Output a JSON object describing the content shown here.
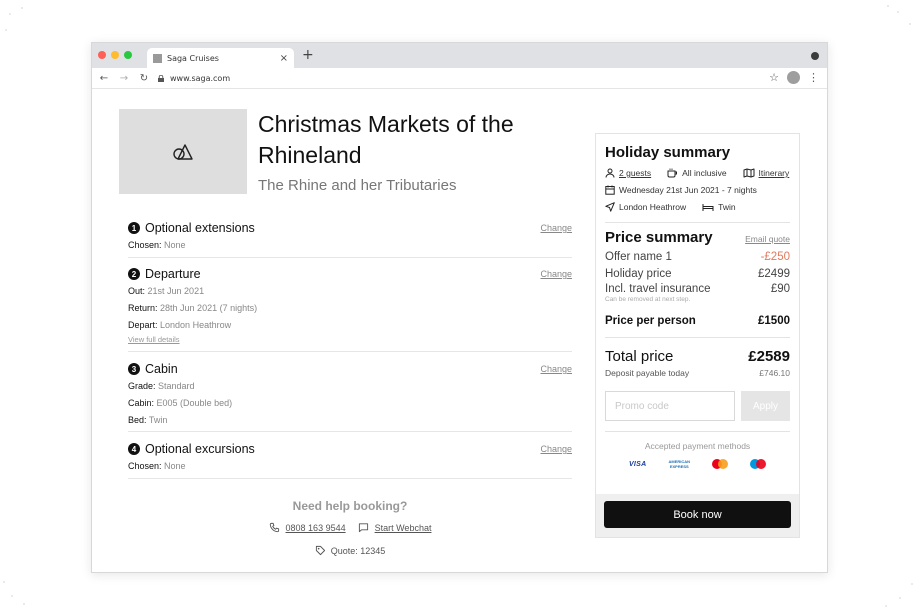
{
  "browser": {
    "tab_title": "Saga Cruises",
    "tab_close": "×",
    "new_tab": "+",
    "url": "www.saga.com",
    "traffic_colors": [
      "#fe5f57",
      "#febc2e",
      "#28c840"
    ]
  },
  "holiday": {
    "title": "Christmas Markets of the Rhineland",
    "subtitle": "The Rhine and her Tributaries",
    "image_icon": "image-placeholder-icon"
  },
  "sections": [
    {
      "number": "1",
      "title": "Optional extensions",
      "change_label": "Change",
      "details": [
        {
          "label": "Chosen:",
          "value": "None"
        }
      ]
    },
    {
      "number": "2",
      "title": "Departure",
      "change_label": "Change",
      "details": [
        {
          "label": "Out:",
          "value": "21st Jun 2021"
        },
        {
          "label": "Return:",
          "value": "28th Jun 2021 (7 nights)"
        },
        {
          "label": "Depart:",
          "value": "London Heathrow"
        }
      ],
      "link": "View full details"
    },
    {
      "number": "3",
      "title": "Cabin",
      "change_label": "Change",
      "details": [
        {
          "label": "Grade:",
          "value": "Standard"
        },
        {
          "label": "Cabin:",
          "value": "E005 (Double bed)"
        },
        {
          "label": "Bed:",
          "value": "Twin"
        }
      ]
    },
    {
      "number": "4",
      "title": "Optional excursions",
      "change_label": "Change",
      "details": [
        {
          "label": "Chosen:",
          "value": "None"
        }
      ]
    }
  ],
  "help": {
    "title": "Need help booking?",
    "phone": "0808 163 9544",
    "webchat": "Start Webchat",
    "quote": "Quote: 12345"
  },
  "summary": {
    "title": "Holiday summary",
    "guests": "2 guests",
    "board": "All inclusive",
    "itinerary": "Itinerary",
    "dates": "Wednesday 21st Jun 2021 - 7 nights",
    "departure": "London Heathrow",
    "bed": "Twin"
  },
  "price": {
    "title": "Price summary",
    "email_quote": "Email quote",
    "lines": [
      {
        "label": "Offer name 1",
        "value": "-£250",
        "discount": true
      },
      {
        "label": "Holiday price",
        "value": "£2499",
        "discount": false
      },
      {
        "label": "Incl. travel insurance",
        "value": "£90",
        "discount": false
      }
    ],
    "insurance_note": "Can be removed at next step.",
    "per_person_label": "Price per person",
    "per_person_value": "£1500",
    "total_label": "Total price",
    "total_value": "£2589",
    "deposit_label": "Deposit payable today",
    "deposit_value": "£746.10",
    "discount_color": "#e07a5f"
  },
  "promo": {
    "placeholder": "Promo code",
    "apply_label": "Apply"
  },
  "payment": {
    "label": "Accepted payment methods",
    "visa": "VISA",
    "amex_line1": "AMERICAN",
    "amex_line2": "EXPRESS"
  },
  "book_now": "Book now"
}
